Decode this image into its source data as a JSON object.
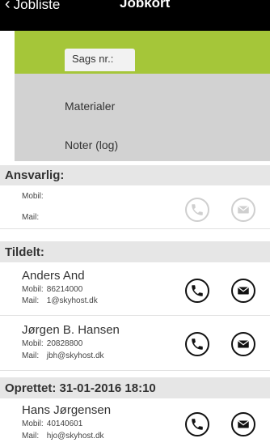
{
  "topbar": {
    "back_label": "Jobliste",
    "title": "Jobkort"
  },
  "case_tab": {
    "label": "Sags nr.:"
  },
  "menu": {
    "items": [
      {
        "label": "Materialer"
      },
      {
        "label": "Noter (log)"
      }
    ]
  },
  "responsible": {
    "header": "Ansvarlig:",
    "mobile_label": "Mobil:",
    "mail_label": "Mail:"
  },
  "assigned": {
    "header": "Tildelt:",
    "people": [
      {
        "name": "Anders And",
        "mobile_label": "Mobil:",
        "mobile": "86214000",
        "mail_label": "Mail:",
        "mail": "1@skyhost.dk"
      },
      {
        "name": "Jørgen B. Hansen",
        "mobile_label": "Mobil:",
        "mobile": "20828800",
        "mail_label": "Mail:",
        "mail": "jbh@skyhost.dk"
      }
    ]
  },
  "created": {
    "header": "Oprettet: 31-01-2016 18:10",
    "person": {
      "name": "Hans Jørgensen",
      "mobile_label": "Mobil:",
      "mobile": "40140601",
      "mail_label": "Mail:",
      "mail": "hjo@skyhost.dk"
    }
  },
  "colors": {
    "accent_green": "#a5c639",
    "section_bg": "#e6e6e6",
    "menu_bg": "#d2d2d2"
  }
}
